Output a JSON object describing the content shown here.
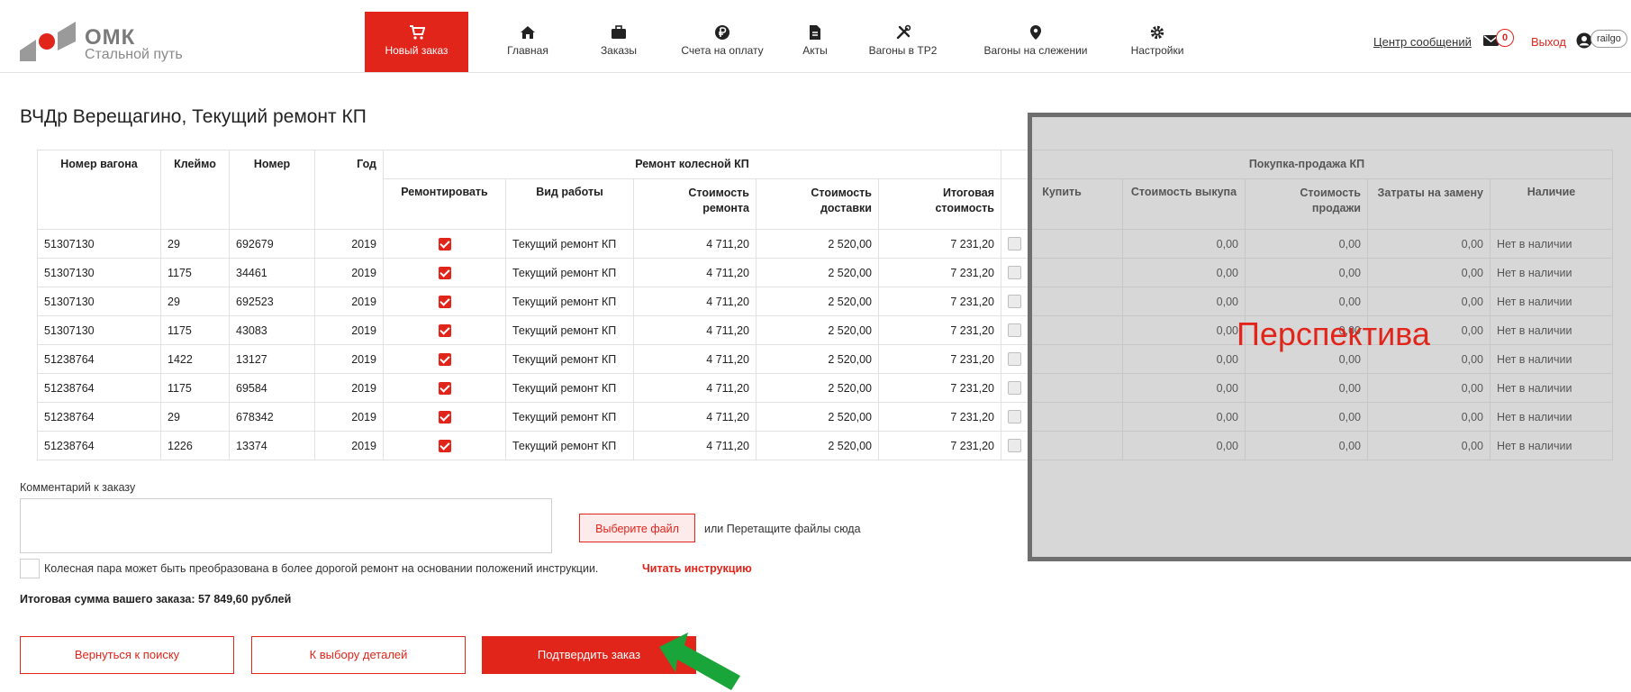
{
  "header": {
    "brand_title": "ОМК",
    "brand_subtitle": "Стальной путь",
    "nav": [
      {
        "label": "Новый заказ",
        "icon": "cart-icon",
        "active": true
      },
      {
        "label": "Главная",
        "icon": "home-icon"
      },
      {
        "label": "Заказы",
        "icon": "briefcase-icon"
      },
      {
        "label": "Счета на оплату",
        "icon": "ruble-icon"
      },
      {
        "label": "Акты",
        "icon": "document-icon"
      },
      {
        "label": "Вагоны в ТР2",
        "icon": "tools-icon"
      },
      {
        "label": "Вагоны на слежении",
        "icon": "map-pin-icon"
      },
      {
        "label": "Настройки",
        "icon": "gear-icon"
      }
    ],
    "message_center": "Центр сообщений",
    "message_count": "0",
    "logout": "Выход",
    "username": "railgo"
  },
  "page": {
    "title": "ВЧДр Верещагино, Текущий ремонт КП"
  },
  "table": {
    "group_headers": {
      "repair": "Ремонт колесной КП",
      "trade": "Покупка-продажа КП"
    },
    "columns": {
      "wagon": "Номер вагона",
      "stamp": "Клеймо",
      "number": "Номер",
      "year": "Год",
      "repair_flag": "Ремонтировать",
      "work_type": "Вид работы",
      "repair_cost": "Стоимость ремонта",
      "delivery_cost": "Стоимость доставки",
      "total_cost": "Итоговая стоимость",
      "buy": "Купить",
      "buyout_cost": "Стоимость выкупа",
      "sale_cost": "Стоимость продажи",
      "replace_cost": "Затраты на замену",
      "availability": "Наличие"
    },
    "rows": [
      {
        "wagon": "51307130",
        "stamp": "29",
        "number": "692679",
        "year": "2019",
        "work_type": "Текущий ремонт КП",
        "repair_cost": "4 711,20",
        "delivery_cost": "2 520,00",
        "total_cost": "7 231,20",
        "buyout_cost": "0,00",
        "sale_cost": "0,00",
        "replace_cost": "0,00",
        "availability": "Нет в наличии"
      },
      {
        "wagon": "51307130",
        "stamp": "1175",
        "number": "34461",
        "year": "2019",
        "work_type": "Текущий ремонт КП",
        "repair_cost": "4 711,20",
        "delivery_cost": "2 520,00",
        "total_cost": "7 231,20",
        "buyout_cost": "0,00",
        "sale_cost": "0,00",
        "replace_cost": "0,00",
        "availability": "Нет в наличии"
      },
      {
        "wagon": "51307130",
        "stamp": "29",
        "number": "692523",
        "year": "2019",
        "work_type": "Текущий ремонт КП",
        "repair_cost": "4 711,20",
        "delivery_cost": "2 520,00",
        "total_cost": "7 231,20",
        "buyout_cost": "0,00",
        "sale_cost": "0,00",
        "replace_cost": "0,00",
        "availability": "Нет в наличии"
      },
      {
        "wagon": "51307130",
        "stamp": "1175",
        "number": "43083",
        "year": "2019",
        "work_type": "Текущий ремонт КП",
        "repair_cost": "4 711,20",
        "delivery_cost": "2 520,00",
        "total_cost": "7 231,20",
        "buyout_cost": "0,00",
        "sale_cost": "0,00",
        "replace_cost": "0,00",
        "availability": "Нет в наличии"
      },
      {
        "wagon": "51238764",
        "stamp": "1422",
        "number": "13127",
        "year": "2019",
        "work_type": "Текущий ремонт КП",
        "repair_cost": "4 711,20",
        "delivery_cost": "2 520,00",
        "total_cost": "7 231,20",
        "buyout_cost": "0,00",
        "sale_cost": "0,00",
        "replace_cost": "0,00",
        "availability": "Нет в наличии"
      },
      {
        "wagon": "51238764",
        "stamp": "1175",
        "number": "69584",
        "year": "2019",
        "work_type": "Текущий ремонт КП",
        "repair_cost": "4 711,20",
        "delivery_cost": "2 520,00",
        "total_cost": "7 231,20",
        "buyout_cost": "0,00",
        "sale_cost": "0,00",
        "replace_cost": "0,00",
        "availability": "Нет в наличии"
      },
      {
        "wagon": "51238764",
        "stamp": "29",
        "number": "678342",
        "year": "2019",
        "work_type": "Текущий ремонт КП",
        "repair_cost": "4 711,20",
        "delivery_cost": "2 520,00",
        "total_cost": "7 231,20",
        "buyout_cost": "0,00",
        "sale_cost": "0,00",
        "replace_cost": "0,00",
        "availability": "Нет в наличии"
      },
      {
        "wagon": "51238764",
        "stamp": "1226",
        "number": "13374",
        "year": "2019",
        "work_type": "Текущий ремонт КП",
        "repair_cost": "4 711,20",
        "delivery_cost": "2 520,00",
        "total_cost": "7 231,20",
        "buyout_cost": "0,00",
        "sale_cost": "0,00",
        "replace_cost": "0,00",
        "availability": "Нет в наличии"
      }
    ]
  },
  "overlay": {
    "label": "Перспектива"
  },
  "form": {
    "comment_label": "Комментарий к заказу",
    "comment_value": "",
    "file_button": "Выберите файл",
    "drop_text": "или Перетащите файлы сюда",
    "agree_text": "Колесная пара может быть преобразована в более дорогой ремонт на основании положений инструкции.",
    "agree_link": "Читать инструкцию",
    "total_text": "Итоговая сумма вашего заказа: 57 849,60 рублей"
  },
  "buttons": {
    "back": "Вернуться к поиску",
    "details": "К выбору деталей",
    "confirm": "Подтвердить заказ"
  },
  "colors": {
    "brand_red": "#e1251b",
    "arrow_green": "#1aa53a",
    "overlay_gray": "#a0a0a0"
  }
}
